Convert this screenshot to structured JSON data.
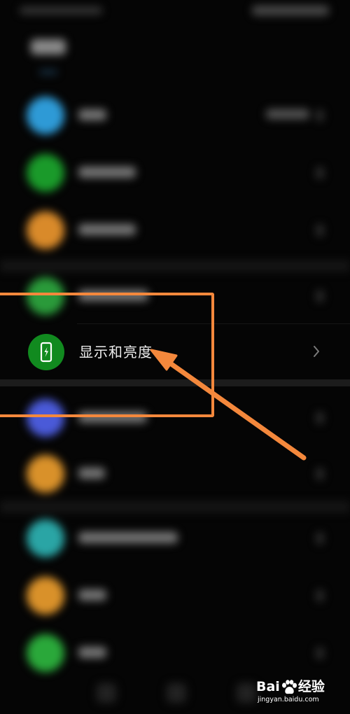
{
  "settings_list": {
    "highlighted_item": {
      "label": "显示和亮度",
      "icon": "phone-brightness-icon",
      "icon_color": "#118a1f"
    },
    "blurred_item_icon_colors": [
      "#2e9ad6",
      "#1a9a2a",
      "#d98a2a",
      "#2a9a3a",
      "#4a5ad8",
      "#d9912a",
      "#2aa5a5",
      "#d9912a",
      "#2aa83a"
    ]
  },
  "annotation": {
    "color": "#f4883c"
  },
  "watermark": {
    "brand_prefix": "Bai",
    "brand_suffix": "经验",
    "url": "jingyan.baidu.com"
  }
}
